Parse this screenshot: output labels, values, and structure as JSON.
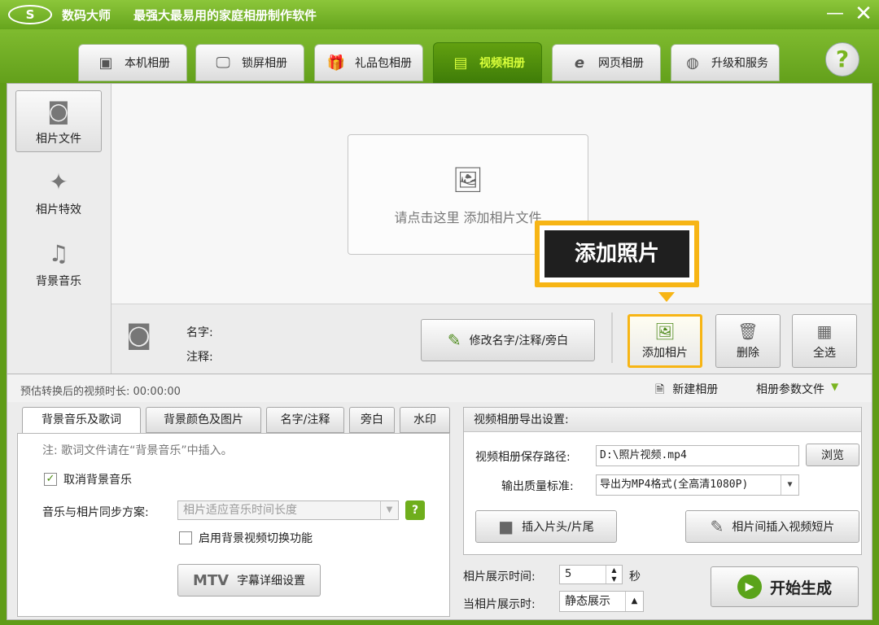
{
  "window": {
    "logo": "S",
    "app_name": "数码大师",
    "slogan": "最强大最易用的家庭相册制作软件",
    "minimize": "—",
    "close": "✕"
  },
  "nav": {
    "tabs": [
      {
        "label": "本机相册",
        "icon": "photo-album-icon"
      },
      {
        "label": "锁屏相册",
        "icon": "monitor-icon"
      },
      {
        "label": "礼品包相册",
        "icon": "gift-icon"
      },
      {
        "label": "视频相册",
        "icon": "film-icon",
        "active": true
      },
      {
        "label": "网页相册",
        "icon": "ie-icon"
      },
      {
        "label": "升级和服务",
        "icon": "globe-icon"
      }
    ],
    "help": "?"
  },
  "left_nav": [
    {
      "label": "相片文件",
      "icon": "camera-icon",
      "active": true
    },
    {
      "label": "相片特效",
      "icon": "effects-icon"
    },
    {
      "label": "背景音乐",
      "icon": "music-note-icon"
    }
  ],
  "photo_area": {
    "add_prompt": "请点击这里  添加相片文件"
  },
  "callout": {
    "text": "添加照片"
  },
  "detail": {
    "name_label": "名字:",
    "note_label": "注释:",
    "rename_button": "修改名字/注释/旁白",
    "add_photo_button": "添加相片",
    "delete_button": "删除",
    "select_all_button": "全选"
  },
  "strip": {
    "duration": "预估转换后的视频时长: 00:00:00",
    "new_album": "新建相册",
    "album_params": "相册参数文件"
  },
  "subtabs": [
    "背景音乐及歌词",
    "背景颜色及图片",
    "名字/注释",
    "旁白",
    "水印"
  ],
  "music_panel": {
    "note": "注: 歌词文件请在“背景音乐”中插入。",
    "cancel_music": "取消背景音乐",
    "cancel_music_checked": true,
    "sync_label": "音乐与相片同步方案:",
    "sync_value": "相片适应音乐时间长度",
    "enable_video_switch": "启用背景视频切换功能",
    "enable_video_switch_checked": false,
    "mtv_tag": "MTV",
    "mtv_button": "字幕详细设置"
  },
  "export": {
    "title": "视频相册导出设置:",
    "path_label": "视频相册保存路径:",
    "path_value": "D:\\照片视频.mp4",
    "browse": "浏览",
    "quality_label": "输出质量标准:",
    "quality_value": "导出为MP4格式(全高清1080P)",
    "insert_head": "插入片头/片尾",
    "insert_clip": "相片间插入视频短片"
  },
  "display": {
    "time_label": "相片展示时间:",
    "time_value": "5",
    "unit": "秒",
    "mode_label": "当相片展示时:",
    "mode_value": "静态展示",
    "start_button": "开始生成"
  }
}
